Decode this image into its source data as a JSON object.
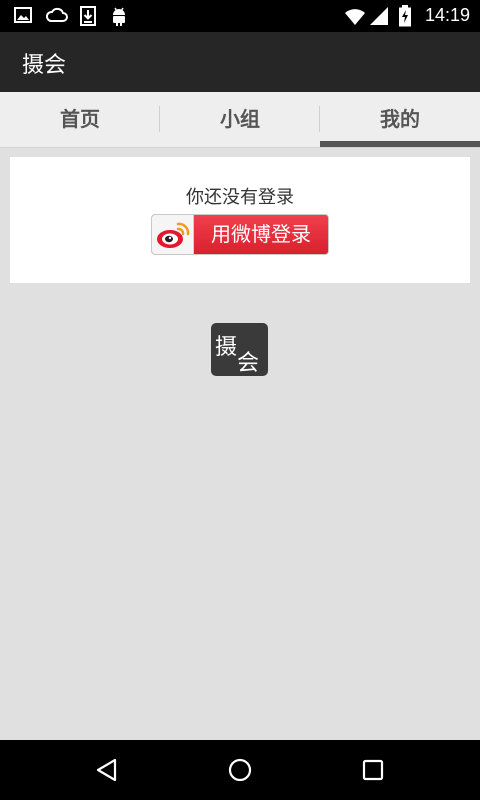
{
  "status_bar": {
    "time": "14:19",
    "icons": [
      "image-notification-icon",
      "cloud-icon",
      "download-icon",
      "android-debug-icon",
      "wifi-icon",
      "cell-signal-icon",
      "battery-charging-icon"
    ]
  },
  "app_bar": {
    "title": "摄会"
  },
  "tabs": [
    {
      "label": "首页",
      "selected": false
    },
    {
      "label": "小组",
      "selected": false
    },
    {
      "label": "我的",
      "selected": true
    }
  ],
  "login_card": {
    "prompt": "你还没有登录",
    "weibo_button_label": "用微博登录"
  },
  "center_logo": {
    "char1": "摄",
    "char2": "会"
  },
  "nav_bar": {
    "buttons": [
      "back-icon",
      "home-icon",
      "recents-icon"
    ]
  },
  "colors": {
    "status_bar": "#000000",
    "app_bar": "#262626",
    "tab_bg": "#eeeeee",
    "tab_indicator": "#555555",
    "page_bg": "#e0e0e0",
    "weibo_red": "#e8313f"
  }
}
